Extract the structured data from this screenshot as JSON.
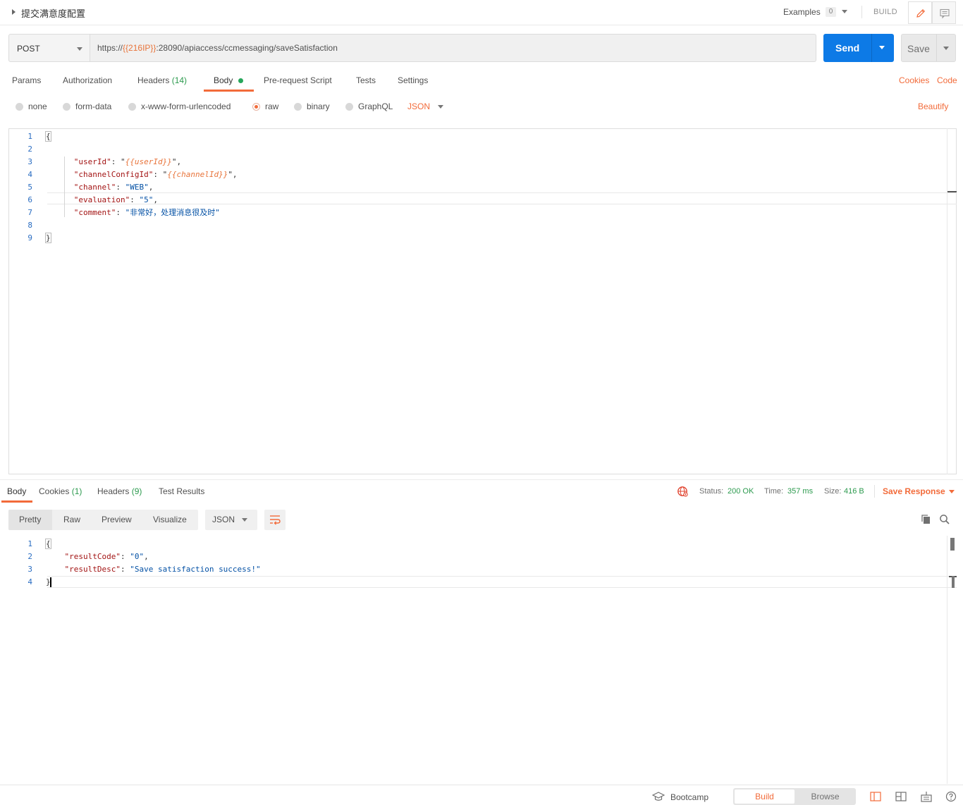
{
  "header": {
    "request_title": "提交满意度配置",
    "examples_label": "Examples",
    "examples_count": "0",
    "build_label": "BUILD"
  },
  "request": {
    "method": "POST",
    "url_prefix": "https://",
    "url_var": "{{216IP}}",
    "url_suffix": ":28090/apiaccess/ccmessaging/saveSatisfaction",
    "send_label": "Send",
    "save_label": "Save"
  },
  "request_tabs": {
    "params": "Params",
    "authorization": "Authorization",
    "headers": "Headers",
    "headers_count": "(14)",
    "body": "Body",
    "prerequest": "Pre-request Script",
    "tests": "Tests",
    "settings": "Settings",
    "cookies": "Cookies",
    "code": "Code"
  },
  "body_types": {
    "none": "none",
    "form_data": "form-data",
    "urlencoded": "x-www-form-urlencoded",
    "raw": "raw",
    "binary": "binary",
    "graphql": "GraphQL",
    "format": "JSON",
    "beautify": "Beautify"
  },
  "request_body": {
    "line_numbers": [
      "1",
      "2",
      "3",
      "4",
      "5",
      "6",
      "7",
      "8",
      "9"
    ],
    "open_brace": "{",
    "close_brace": "}",
    "fields": [
      {
        "key": "\"userId\"",
        "value_var": "{{userId}}",
        "value_plain": ""
      },
      {
        "key": "\"channelConfigId\"",
        "value_var": "{{channelId}}",
        "value_plain": ""
      },
      {
        "key": "\"channel\"",
        "value_var": "",
        "value_plain": "\"WEB\""
      },
      {
        "key": "\"evaluation\"",
        "value_var": "",
        "value_plain": "\"5\""
      },
      {
        "key": "\"comment\"",
        "value_var": "",
        "value_plain": "\"非常好，处理消息很及时\""
      }
    ]
  },
  "response_tabs": {
    "body": "Body",
    "cookies": "Cookies",
    "cookies_count": "(1)",
    "headers": "Headers",
    "headers_count": "(9)",
    "test_results": "Test Results"
  },
  "response_status": {
    "status_label": "Status:",
    "status_value": "200 OK",
    "time_label": "Time:",
    "time_value": "357 ms",
    "size_label": "Size:",
    "size_value": "416 B",
    "save_response": "Save Response"
  },
  "response_view": {
    "pretty": "Pretty",
    "raw": "Raw",
    "preview": "Preview",
    "visualize": "Visualize",
    "format": "JSON"
  },
  "response_body": {
    "line_numbers": [
      "1",
      "2",
      "3",
      "4"
    ],
    "open_brace": "{",
    "close_brace": "}",
    "result_code_key": "\"resultCode\"",
    "result_code_value": "\"0\"",
    "result_desc_key": "\"resultDesc\"",
    "result_desc_value": "\"Save satisfaction success!\""
  },
  "footer": {
    "bootcamp": "Bootcamp",
    "build": "Build",
    "browse": "Browse"
  },
  "colors": {
    "accent": "#f26b3a",
    "send_blue": "#0d7ae6",
    "count_green": "#2c9a4e"
  }
}
